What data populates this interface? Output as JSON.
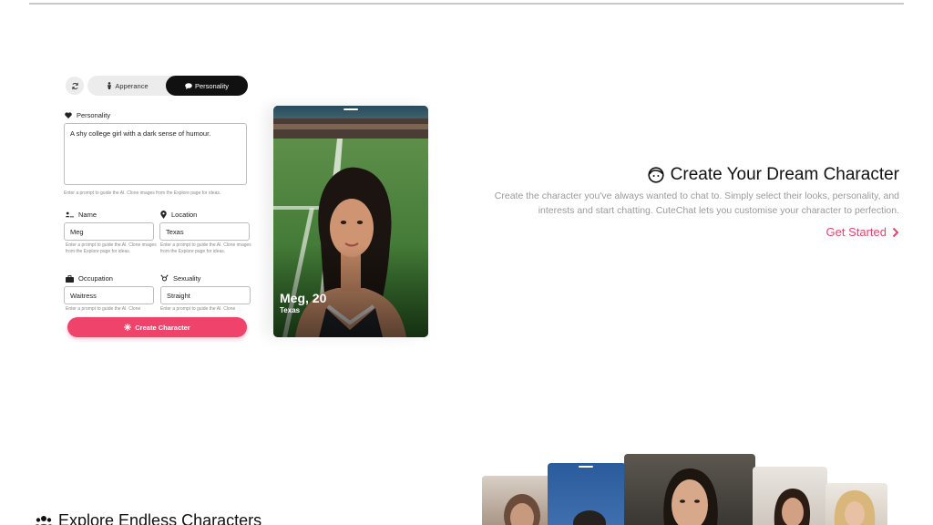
{
  "builder": {
    "tabs": [
      {
        "label": "Apperance",
        "icon": "person-icon",
        "active": false
      },
      {
        "label": "Personality",
        "icon": "chat-bubble-icon",
        "active": true
      }
    ],
    "personality": {
      "label": "Personality",
      "value": "A shy college girl with a dark sense of humour.",
      "help": "Enter a prompt to guide the AI. Clone images from the Explore page for ideas."
    },
    "name": {
      "label": "Name",
      "value": "Meg",
      "help": "Enter a prompt to guide the AI. Clone images from the Explore page for ideas."
    },
    "location": {
      "label": "Location",
      "value": "Texas",
      "help": "Enter a prompt to guide the AI. Clone images from the Explore page for ideas."
    },
    "occupation": {
      "label": "Occupation",
      "value": "Waitress",
      "help": "Enter a prompt to guide the AI. Clone"
    },
    "sexuality": {
      "label": "Sexuality",
      "value": "Straight",
      "help": "Enter a prompt to guide the AI. Clone"
    },
    "create_button": "Create Character"
  },
  "card": {
    "name": "Meg, 20",
    "location": "Texas"
  },
  "hero": {
    "title": "Create Your Dream Character",
    "description": "Create the character you've always wanted to chat to. Simply select their looks, personality, and interests and start chatting. CuteChat lets you customise your character to perfection.",
    "cta": "Get Started",
    "accent": "#e8436d"
  },
  "section2": {
    "title": "Explore Endless Characters"
  }
}
